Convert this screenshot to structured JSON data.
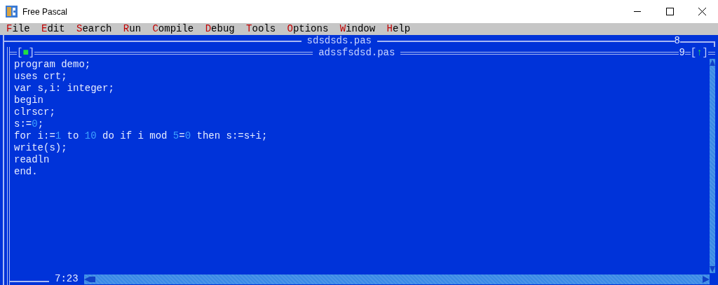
{
  "window": {
    "title": "Free Pascal"
  },
  "menu": [
    {
      "label": "File"
    },
    {
      "label": "Edit"
    },
    {
      "label": "Search"
    },
    {
      "label": "Run"
    },
    {
      "label": "Compile"
    },
    {
      "label": "Debug"
    },
    {
      "label": "Tools"
    },
    {
      "label": "Options"
    },
    {
      "label": "Window"
    },
    {
      "label": "Help"
    }
  ],
  "background_window": {
    "title": "sdsdsds.pas",
    "number": "8"
  },
  "editor": {
    "title": "adssfsdsd.pas",
    "number": "9",
    "close_box": "[■]",
    "zoom_box": "[↑]",
    "cursor_position": "7:23",
    "lines": [
      [
        {
          "kind": "code",
          "text": "program demo;"
        }
      ],
      [
        {
          "kind": "code",
          "text": "uses crt;"
        }
      ],
      [
        {
          "kind": "code",
          "text": "var s,i: integer;"
        }
      ],
      [
        {
          "kind": "code",
          "text": "begin"
        }
      ],
      [
        {
          "kind": "code",
          "text": "clrscr;"
        }
      ],
      [
        {
          "kind": "code",
          "text": "s:="
        },
        {
          "kind": "number",
          "text": "0"
        },
        {
          "kind": "code",
          "text": ";"
        }
      ],
      [
        {
          "kind": "code",
          "text": "for i:="
        },
        {
          "kind": "number",
          "text": "1"
        },
        {
          "kind": "code",
          "text": " to "
        },
        {
          "kind": "number",
          "text": "10"
        },
        {
          "kind": "code",
          "text": " do if i mod "
        },
        {
          "kind": "number",
          "text": "5"
        },
        {
          "kind": "code",
          "text": "="
        },
        {
          "kind": "number",
          "text": "0"
        },
        {
          "kind": "code",
          "text": " then s:=s+i;"
        }
      ],
      [
        {
          "kind": "code",
          "text": "write(s);"
        }
      ],
      [
        {
          "kind": "code",
          "text": "readln"
        }
      ],
      [
        {
          "kind": "code",
          "text": "end."
        }
      ]
    ]
  }
}
